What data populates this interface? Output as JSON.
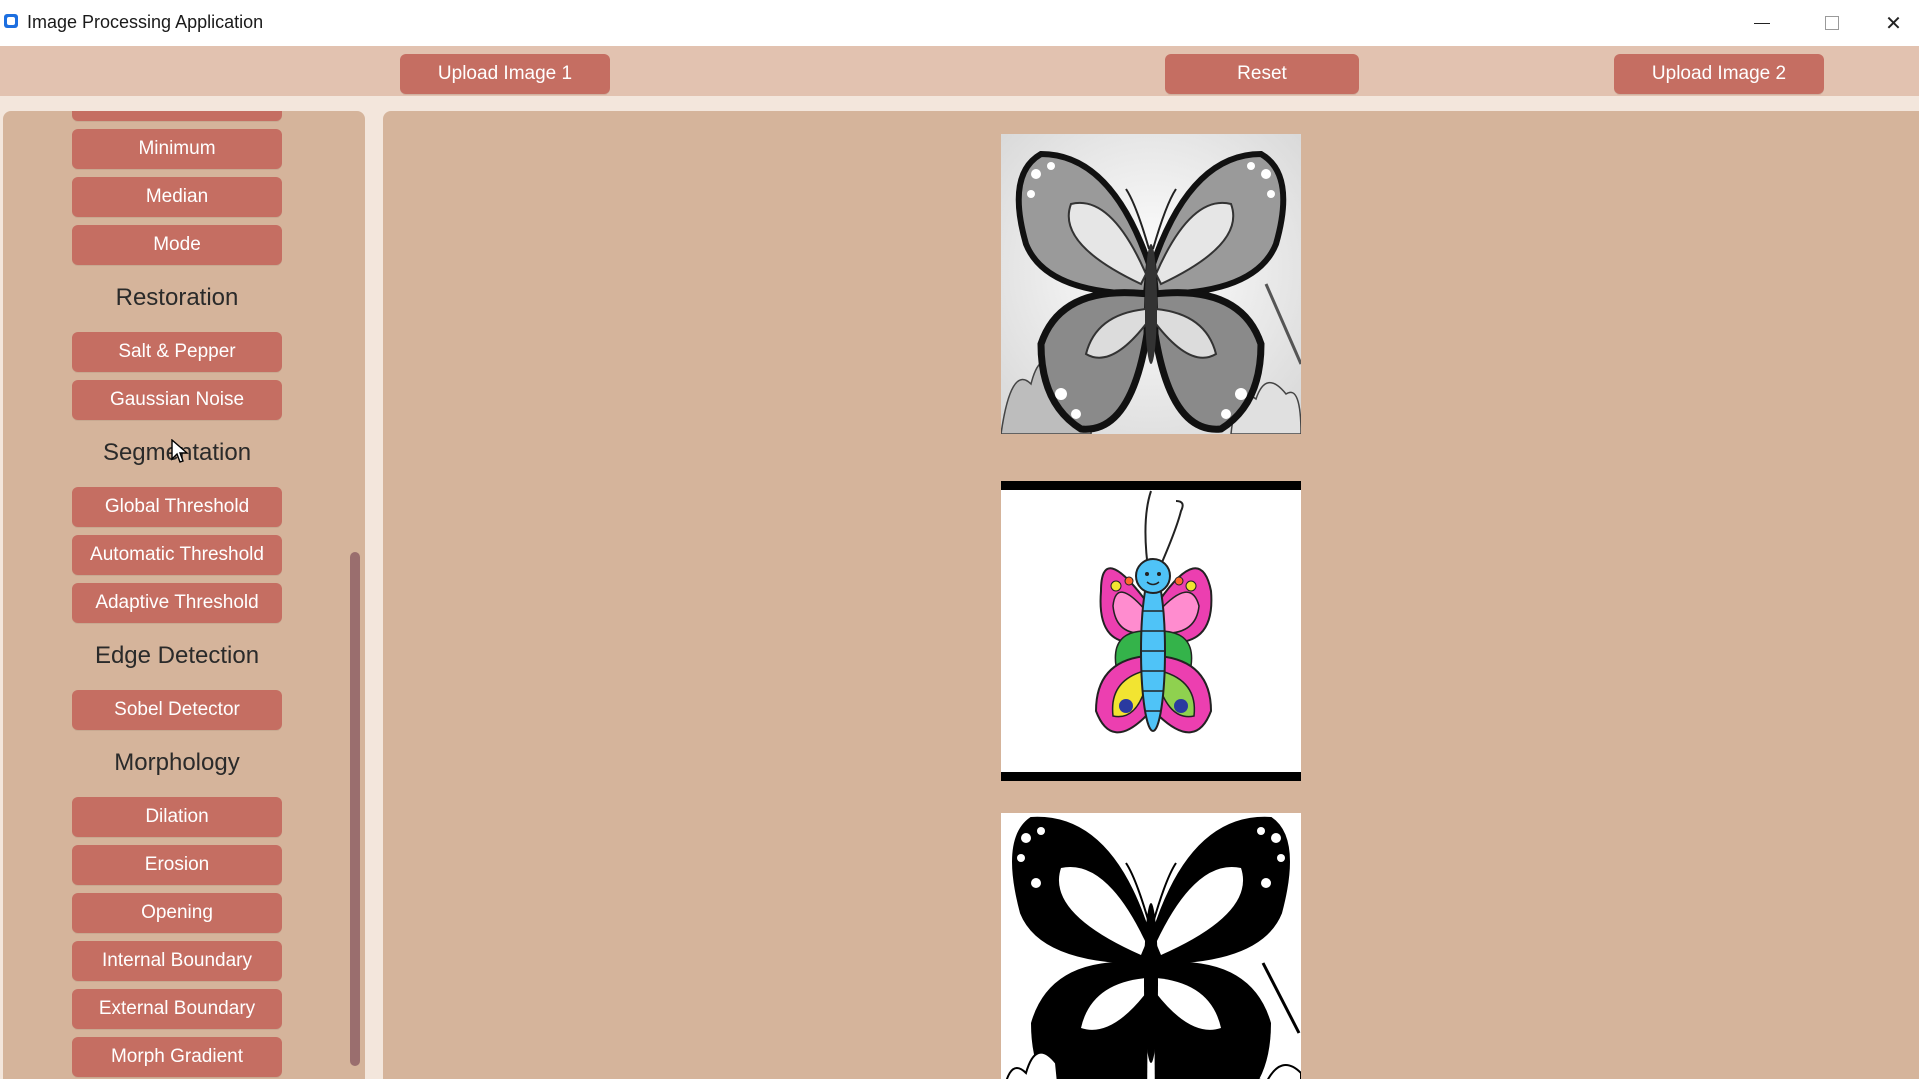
{
  "window": {
    "title": "Image Processing Application",
    "minimize_label": "",
    "maximize_label": "",
    "close_label": "✕"
  },
  "toolbar": {
    "upload1_label": "Upload Image 1",
    "reset_label": "Reset",
    "upload2_label": "Upload Image 2"
  },
  "sidebar": {
    "buttons_top": [
      "Minimum",
      "Median",
      "Mode"
    ],
    "headings": {
      "restoration": "Restoration",
      "segmentation": "Segmentation",
      "edge_detection": "Edge Detection",
      "morphology": "Morphology"
    },
    "restoration_buttons": [
      "Salt & Pepper",
      "Gaussian Noise"
    ],
    "segmentation_buttons": [
      "Global Threshold",
      "Automatic Threshold",
      "Adaptive Threshold"
    ],
    "edge_buttons": [
      "Sobel Detector"
    ],
    "morphology_buttons": [
      "Dilation",
      "Erosion",
      "Opening",
      "Internal Boundary",
      "External Boundary",
      "Morph Gradient"
    ]
  },
  "colors": {
    "button": "#c56e62",
    "panel": "#d5b49b",
    "toolbar": "#e2c2b0",
    "scrollbar": "#9a6e6e"
  },
  "images": [
    {
      "name": "grayscale-butterfly-image"
    },
    {
      "name": "colored-butterfly-image"
    },
    {
      "name": "binary-butterfly-image"
    }
  ]
}
